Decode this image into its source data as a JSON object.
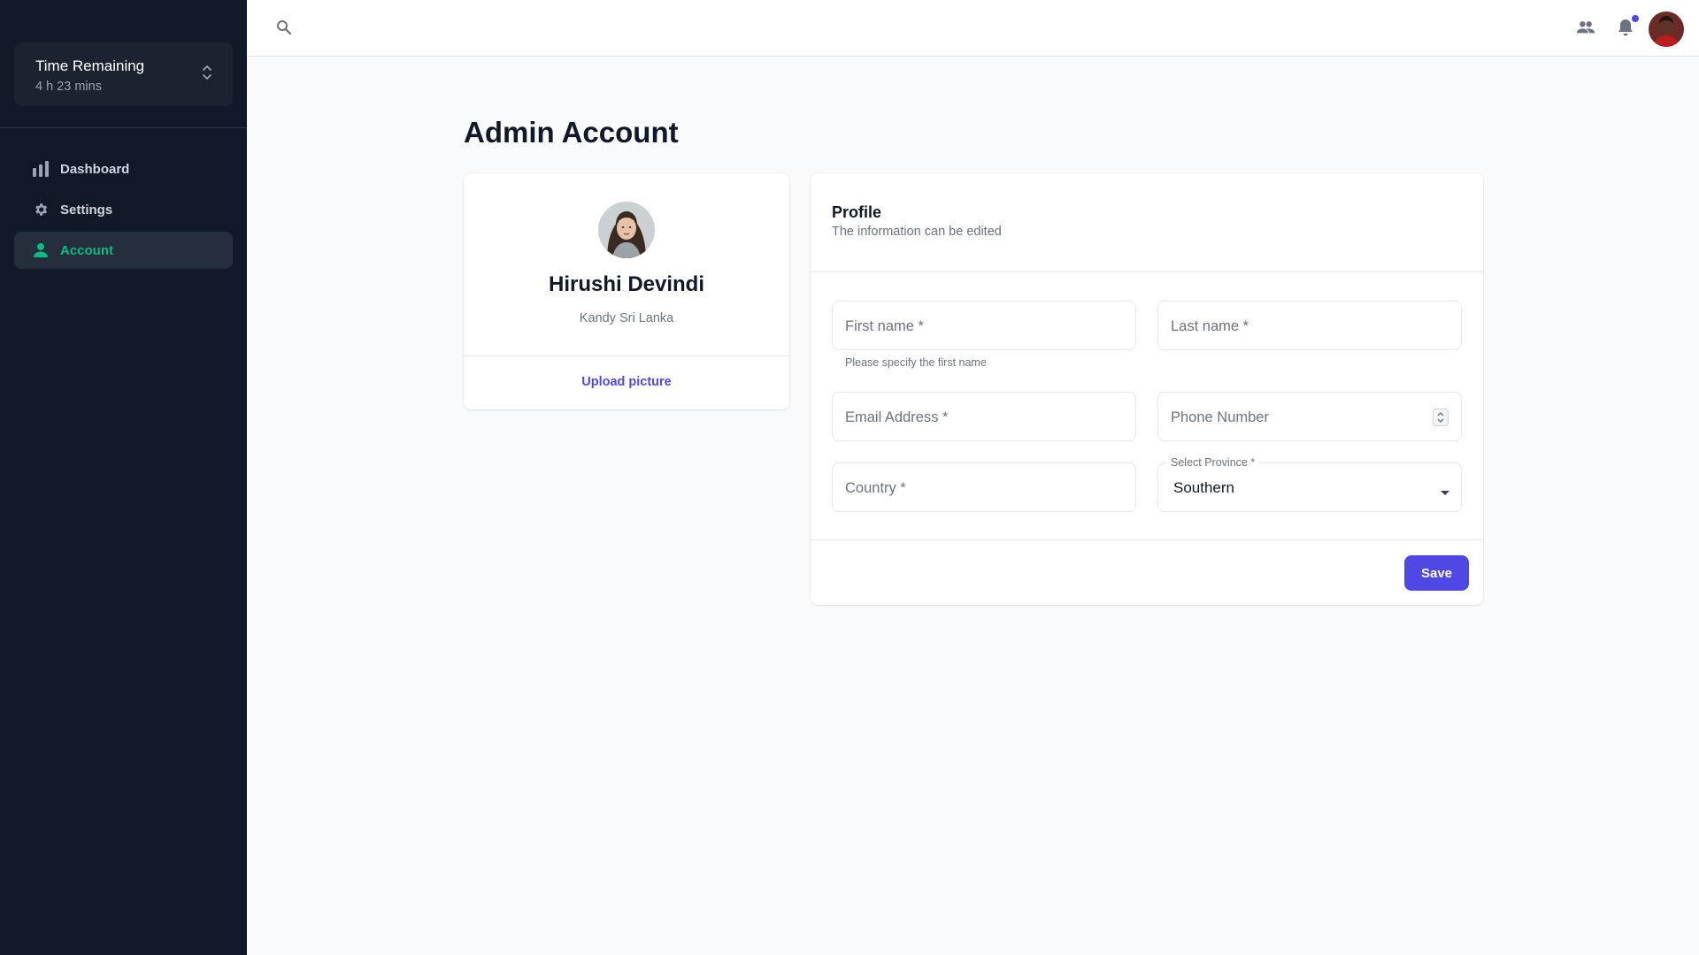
{
  "sidebar": {
    "workspace": {
      "title": "Time Remaining",
      "subtitle": "4 h 23 mins"
    },
    "items": [
      {
        "label": "Dashboard",
        "icon": "bar-chart-icon"
      },
      {
        "label": "Settings",
        "icon": "gear-icon"
      },
      {
        "label": "Account",
        "icon": "user-icon",
        "active": true
      }
    ]
  },
  "topbar": {
    "icons": [
      "search-icon",
      "people-icon",
      "bell-icon",
      "user-avatar"
    ],
    "notification_dot_color": "#5048e5"
  },
  "page": {
    "title": "Admin Account"
  },
  "user_card": {
    "name": "Hirushi Devindi",
    "location": "Kandy Sri Lanka",
    "upload_label": "Upload picture"
  },
  "profile": {
    "title": "Profile",
    "subtitle": "The information can be edited",
    "fields": {
      "first_name": {
        "placeholder": "First name *",
        "helper": "Please specify the first name"
      },
      "last_name": {
        "placeholder": "Last name *"
      },
      "email": {
        "placeholder": "Email Address *"
      },
      "phone": {
        "placeholder": "Phone Number"
      },
      "country": {
        "placeholder": "Country *"
      },
      "province": {
        "label": "Select Province *",
        "value": "Southern"
      }
    },
    "save_label": "Save"
  },
  "colors": {
    "sidebar_bg": "#111827",
    "accent_green": "#10b981",
    "primary": "#5048e5",
    "page_bg": "#f9fafc"
  }
}
